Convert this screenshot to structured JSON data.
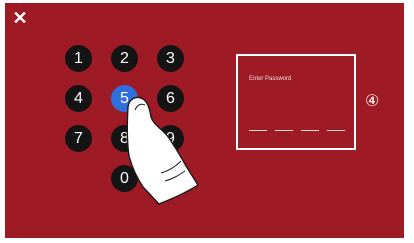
{
  "window": {
    "close_symbol": "✕"
  },
  "keypad": {
    "keys": [
      "1",
      "2",
      "3",
      "4",
      "5",
      "6",
      "7",
      "8",
      "9",
      "0"
    ],
    "active_key": "5"
  },
  "password": {
    "label": "Enter Password",
    "digit_slots": 4
  },
  "annotation": {
    "callout": "④"
  },
  "colors": {
    "background": "#9e1a24",
    "key": "#141414",
    "active_key": "#2f6fde",
    "text": "#ffffff"
  }
}
